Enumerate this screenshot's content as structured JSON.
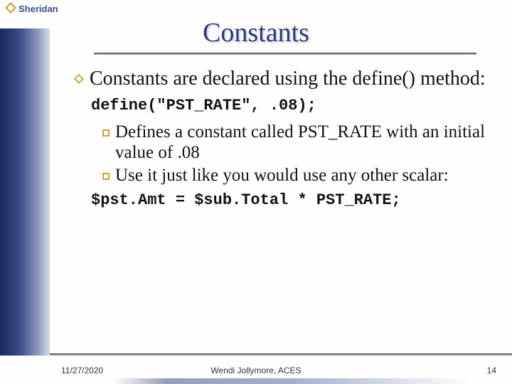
{
  "brand": "Sheridan",
  "title": "Constants",
  "bullets": {
    "main": "Constants are declared using the define() method:",
    "code1": "define(\"PST_RATE\", .08);",
    "sub1": "Defines a constant called PST_RATE with an initial value of .08",
    "sub2": "Use it just like you would use any other scalar:",
    "code2": "$pst.Amt = $sub.Total * PST_RATE;"
  },
  "footer": {
    "date": "11/27/2020",
    "author": "Wendi Jollymore, ACES",
    "page": "14"
  }
}
